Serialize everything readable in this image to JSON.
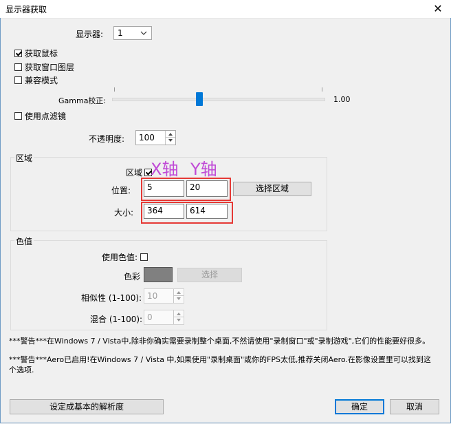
{
  "window": {
    "title": "显示器获取",
    "close_glyph": "✕"
  },
  "monitor": {
    "label": "显示器:",
    "selected": "1"
  },
  "options": {
    "capture_cursor": {
      "label": "获取鼠标",
      "checked": true
    },
    "capture_layered": {
      "label": "获取窗口图层",
      "checked": false
    },
    "compat_mode": {
      "label": "兼容模式",
      "checked": false
    },
    "use_filter": {
      "label": "使用点滤镜",
      "checked": false
    }
  },
  "gamma": {
    "label": "Gamma校正:",
    "value_text": "1.00",
    "fraction": 0.41
  },
  "opacity": {
    "label": "不透明度:",
    "value": "100"
  },
  "region": {
    "group_title": "区域",
    "checkbox_label": "区域",
    "checked": true,
    "position_label": "位置:",
    "x": "5",
    "y": "20",
    "select_button": "选择区域",
    "size_label": "大小:",
    "width": "364",
    "height": "614"
  },
  "annotations": {
    "x_axis": "X轴",
    "y_axis": "Y轴",
    "color": "#c04ad6",
    "box_color": "#e53935"
  },
  "color_key": {
    "group_title": "色值",
    "use_label": "使用色值:",
    "use_checked": false,
    "color_label": "色彩",
    "swatch": "#808080",
    "select_button": "选择",
    "similarity_label": "相似性 (1-100):",
    "similarity": "10",
    "blend_label": "混合 (1-100):",
    "blend": "0"
  },
  "warnings": {
    "w1": "***警告***在Windows 7 / Vista中,除非你确实需要录制整个桌面,不然请使用\"录制窗口\"或\"录制游戏\",它们的性能要好很多。",
    "w2": "***警告***Aero已启用!在Windows 7 / Vista 中,如果使用\"录制桌面\"或你的FPS太低,推荐关闭Aero.在影像设置里可以找到这个选项."
  },
  "buttons": {
    "base_resolution": "设定成基本的解析度",
    "ok": "确定",
    "cancel": "取消"
  }
}
